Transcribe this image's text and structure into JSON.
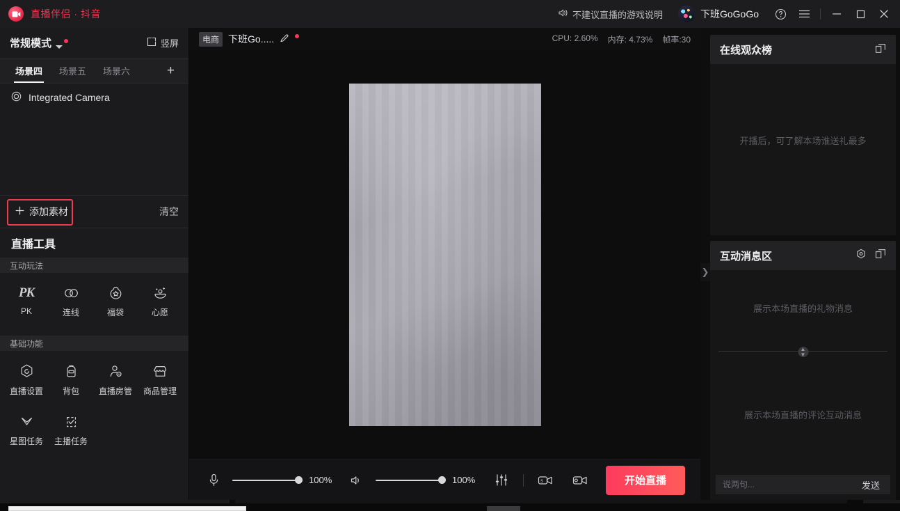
{
  "titlebar": {
    "logo_icon": "camera-logo-icon",
    "app_title": "直播伴侣 · 抖音",
    "notice_icon": "speaker-icon",
    "notice_text": "不建议直播的游戏说明",
    "username": "下班GoGoGo",
    "help_icon": "help-circle-icon",
    "menu_icon": "hamburger-menu-icon",
    "minimize_icon": "minimize-icon",
    "maximize_icon": "maximize-icon",
    "close_icon": "close-icon"
  },
  "sidebar": {
    "mode_name": "常规模式",
    "screen_mode": "竖屏",
    "screen_icon": "portrait-screen-icon",
    "scene_tabs": [
      {
        "label": "场景四",
        "active": true
      },
      {
        "label": "场景五",
        "active": false
      },
      {
        "label": "场景六",
        "active": false
      }
    ],
    "add_scene_label": "+",
    "sources": [
      {
        "label": "Integrated Camera",
        "icon": "camera-source-icon"
      }
    ],
    "add_material_label": "添加素材",
    "clear_label": "清空",
    "tools_title": "直播工具",
    "groups": [
      {
        "title": "互动玩法",
        "tools": [
          {
            "label": "PK",
            "icon": "pk-icon"
          },
          {
            "label": "连线",
            "icon": "link-rings-icon"
          },
          {
            "label": "福袋",
            "icon": "lucky-bag-icon"
          },
          {
            "label": "心愿",
            "icon": "wish-icon"
          }
        ]
      },
      {
        "title": "基础功能",
        "tools": [
          {
            "label": "直播设置",
            "icon": "settings-gear-icon"
          },
          {
            "label": "背包",
            "icon": "backpack-icon"
          },
          {
            "label": "直播房管",
            "icon": "room-admin-icon"
          },
          {
            "label": "商品管理",
            "icon": "shop-icon"
          },
          {
            "label": "星图任务",
            "icon": "star-chart-icon"
          },
          {
            "label": "主播任务",
            "icon": "clipboard-check-icon"
          }
        ]
      }
    ]
  },
  "center": {
    "badge": "电商",
    "room_title": "下班Go.....",
    "edit_icon": "pencil-edit-icon",
    "perf": {
      "cpu": "CPU: 2.60%",
      "memory": "内存: 4.73%",
      "fps": "帧率:30"
    },
    "controls": {
      "mic_icon": "microphone-icon",
      "mic_value": "100%",
      "speaker_icon": "speaker-volume-icon",
      "speaker_value": "100%",
      "mixer_icon": "audio-mixer-icon",
      "screenshare_icon": "screen-share-icon",
      "camera_icon": "camera-toggle-icon",
      "go_live_label": "开始直播"
    },
    "collapse_icon": "chevron-right-icon"
  },
  "right": {
    "viewers": {
      "title": "在线观众榜",
      "expand_icon": "popout-window-icon",
      "placeholder": "开播后，可了解本场谁送礼最多"
    },
    "messages": {
      "title": "互动消息区",
      "settings_icon": "settings-hex-icon",
      "expand_icon": "popout-window-icon",
      "gift_placeholder": "展示本场直播的礼物消息",
      "comment_placeholder": "展示本场直播的评论互动消息",
      "chat_placeholder": "说两句...",
      "send_label": "发送"
    }
  },
  "colors": {
    "accent_red": "#ef3554",
    "go_live_gradient_start": "#fe3b5c",
    "go_live_gradient_end": "#ff5b5b",
    "highlight_box": "#ef3b4f"
  }
}
